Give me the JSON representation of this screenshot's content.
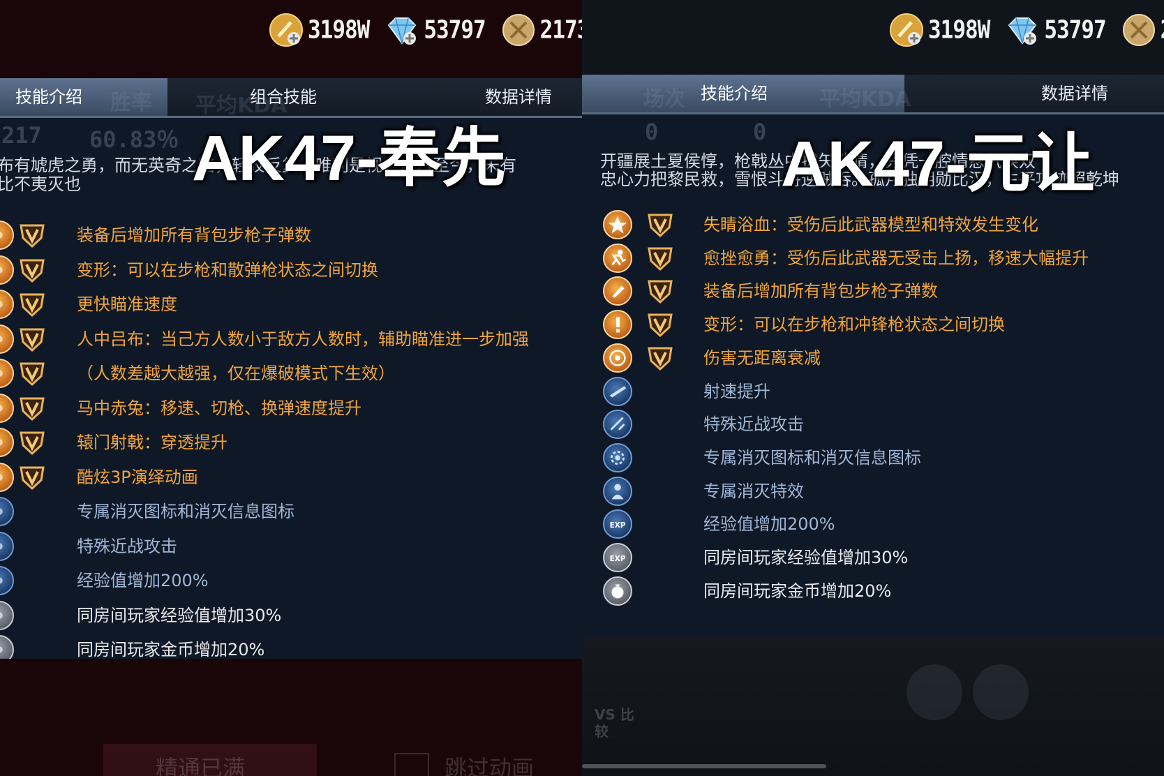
{
  "currency": [
    {
      "icon": "gold-coin-icon",
      "value": "3198W"
    },
    {
      "icon": "diamond-icon",
      "value": "53797"
    },
    {
      "icon": "medal-coin-icon",
      "value": "2173"
    }
  ],
  "left": {
    "overlay_title": "AK47-奉先",
    "tabs": [
      {
        "label": "技能介绍"
      },
      {
        "label": "组合技能"
      },
      {
        "label": "数据详情"
      }
    ],
    "ghost_headers": [
      "胜率",
      "平均KDA"
    ],
    "ghost_stats": [
      "217",
      "60.83％"
    ],
    "lore_lines": [
      "布有虓虎之勇，而无英奇之略，轻狡反复，唯利是视。自古至今，未有",
      "比不夷灭也"
    ],
    "skills": [
      {
        "text": "装备后增加所有背包步枪子弹数",
        "tier": "gold",
        "v": true
      },
      {
        "text": "变形：可以在步枪和散弹枪状态之间切换",
        "tier": "gold",
        "v": true
      },
      {
        "text": "更快瞄准速度",
        "tier": "gold",
        "v": true
      },
      {
        "text": "人中吕布：当己方人数小于敌方人数时，辅助瞄准进一步加强",
        "tier": "gold",
        "v": true
      },
      {
        "text": "（人数差越大越强，仅在爆破模式下生效）",
        "tier": "gold",
        "v": true
      },
      {
        "text": "马中赤兔：移速、切枪、换弹速度提升",
        "tier": "gold",
        "v": true
      },
      {
        "text": "辕门射戟：穿透提升",
        "tier": "gold",
        "v": true
      },
      {
        "text": "酷炫3P演绎动画",
        "tier": "gold",
        "v": true
      },
      {
        "text": "专属消灭图标和消灭信息图标",
        "tier": "blue",
        "v": false
      },
      {
        "text": "特殊近战攻击",
        "tier": "blue",
        "v": false
      },
      {
        "text": "经验值增加200%",
        "tier": "blue",
        "v": false
      },
      {
        "text": "同房间玩家经验值增加30%",
        "tier": "white",
        "v": false
      },
      {
        "text": "同房间玩家金币增加20%",
        "tier": "white",
        "v": false
      }
    ],
    "bottom_buttons": [
      "精通已满",
      "跳过动画"
    ]
  },
  "right": {
    "overlay_title": "AK47-元让",
    "tabs": [
      {
        "label": "技能介绍"
      },
      {
        "label": "数据详情"
      }
    ],
    "ghost_headers": [
      "场次",
      "平均KDA"
    ],
    "ghost_stats": [
      "0",
      "0"
    ],
    "lore_lines": [
      "开疆展土夏侯惇，枪戟丛中拔矢啖睛，只凭一腔情忿气唤双",
      "忠心力把黎民救，雪恨斗将逆贼吞。孤月独明勋比汉，生平功迹照乾坤"
    ],
    "skills": [
      {
        "text": "失睛浴血：受伤后此武器模型和特效发生变化",
        "tier": "gold",
        "icon": "star-icon",
        "v": true
      },
      {
        "text": "愈挫愈勇：受伤后此武器无受击上扬，移速大幅提升",
        "tier": "gold",
        "icon": "running-icon",
        "v": true
      },
      {
        "text": "装备后增加所有背包步枪子弹数",
        "tier": "gold",
        "icon": "bullet-icon",
        "v": true
      },
      {
        "text": "变形：可以在步枪和冲锋枪状态之间切换",
        "tier": "gold",
        "icon": "exclaim-icon",
        "v": true
      },
      {
        "text": "伤害无距离衰减",
        "tier": "gold",
        "icon": "target-icon",
        "v": true
      },
      {
        "text": "射速提升",
        "tier": "blue",
        "icon": "rifle-icon",
        "v": false
      },
      {
        "text": "特殊近战攻击",
        "tier": "blue",
        "icon": "melee-icon",
        "v": false
      },
      {
        "text": "专属消灭图标和消灭信息图标",
        "tier": "blue",
        "icon": "gear-icon",
        "v": false
      },
      {
        "text": "专属消灭特效",
        "tier": "blue",
        "icon": "soldier-icon",
        "v": false
      },
      {
        "text": "经验值增加200%",
        "tier": "blue",
        "icon": "exp-icon",
        "v": false
      },
      {
        "text": "同房间玩家经验值增加30%",
        "tier": "white",
        "icon": "exp-icon",
        "v": false
      },
      {
        "text": "同房间玩家金币增加20%",
        "tier": "white",
        "icon": "coin-bag-icon",
        "v": false
      }
    ],
    "bottom_label": "VS 比较"
  },
  "colors": {
    "gold_text": "#f0a53c",
    "blue_text": "#9fb6d6",
    "white_text": "#e8eaee",
    "left_bg": "#1a0508",
    "right_bg": "#10141b"
  }
}
